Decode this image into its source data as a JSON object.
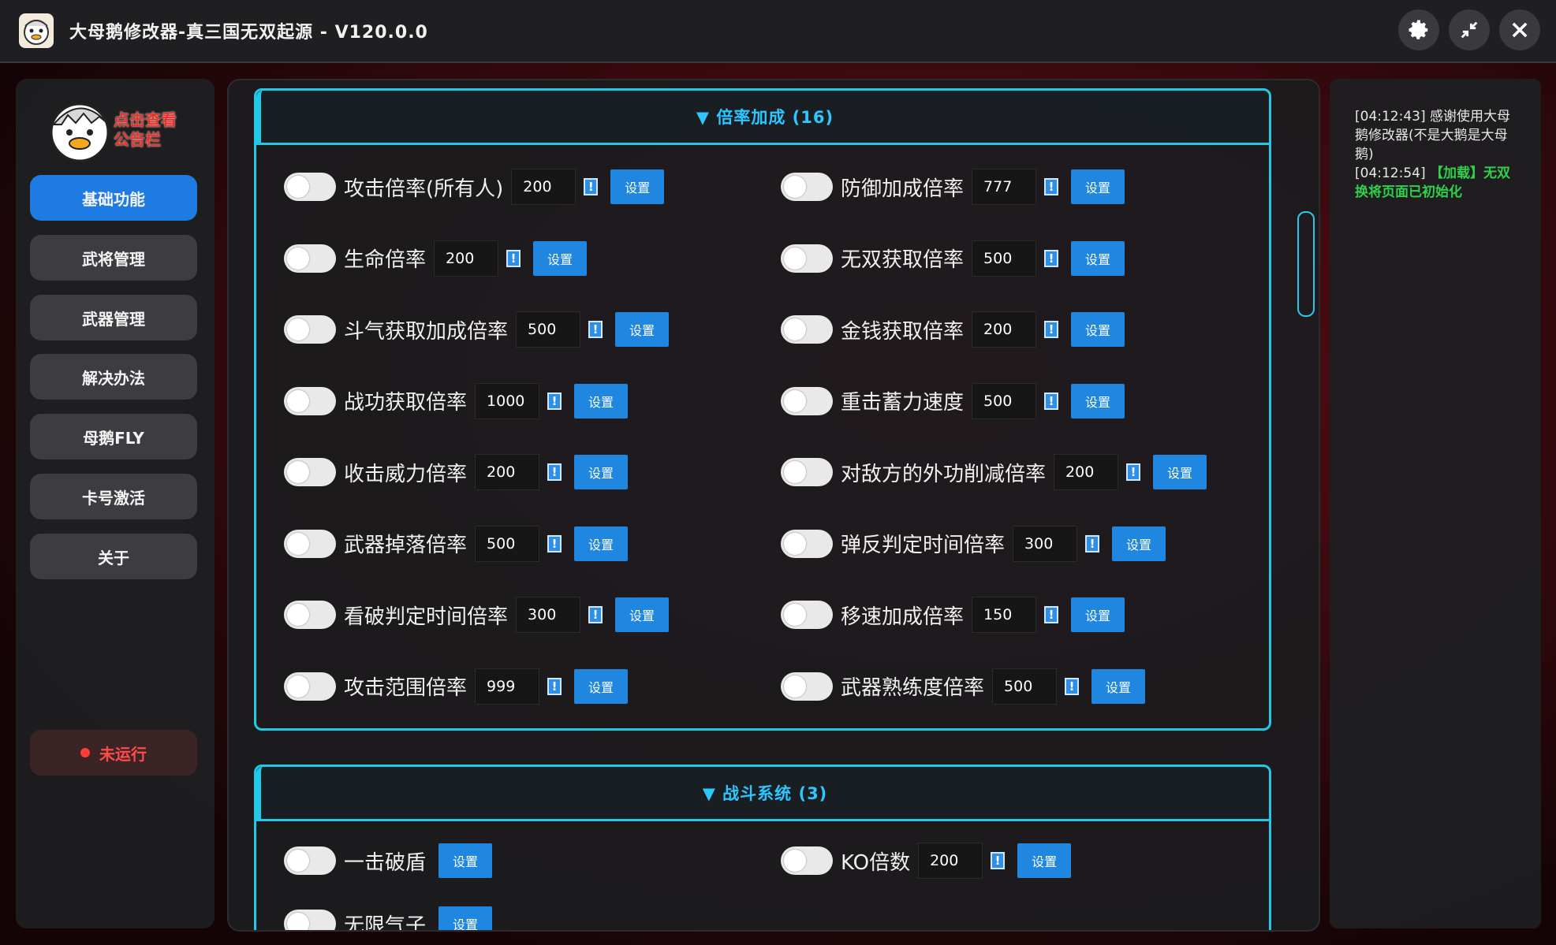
{
  "window": {
    "title": "大母鹅修改器-真三国无双起源 - V120.0.0"
  },
  "sidebar": {
    "notice_label": "点击查看公告栏",
    "items": [
      "基础功能",
      "武将管理",
      "武器管理",
      "解决办法",
      "母鹅FLY",
      "卡号激活",
      "关于"
    ],
    "active_index": 0,
    "status": "未运行"
  },
  "sections": [
    {
      "title": "▼ 倍率加成 (16)",
      "items": [
        {
          "label": "攻击倍率(所有人)",
          "value": "200",
          "button": "设置"
        },
        {
          "label": "防御加成倍率",
          "value": "777",
          "button": "设置"
        },
        {
          "label": "生命倍率",
          "value": "200",
          "button": "设置"
        },
        {
          "label": "无双获取倍率",
          "value": "500",
          "button": "设置"
        },
        {
          "label": "斗气获取加成倍率",
          "value": "500",
          "button": "设置"
        },
        {
          "label": "金钱获取倍率",
          "value": "200",
          "button": "设置"
        },
        {
          "label": "战功获取倍率",
          "value": "1000",
          "button": "设置"
        },
        {
          "label": "重击蓄力速度",
          "value": "500",
          "button": "设置"
        },
        {
          "label": "收击威力倍率",
          "value": "200",
          "button": "设置"
        },
        {
          "label": "对敌方的外功削减倍率",
          "value": "200",
          "button": "设置"
        },
        {
          "label": "武器掉落倍率",
          "value": "500",
          "button": "设置"
        },
        {
          "label": "弹反判定时间倍率",
          "value": "300",
          "button": "设置"
        },
        {
          "label": "看破判定时间倍率",
          "value": "300",
          "button": "设置"
        },
        {
          "label": "移速加成倍率",
          "value": "150",
          "button": "设置"
        },
        {
          "label": "攻击范围倍率",
          "value": "999",
          "button": "设置"
        },
        {
          "label": "武器熟练度倍率",
          "value": "500",
          "button": "设置"
        }
      ]
    },
    {
      "title": "▼ 战斗系统 (3)",
      "items": [
        {
          "label": "一击破盾",
          "value": "",
          "button": "设置"
        },
        {
          "label": "KO倍数",
          "value": "200",
          "button": "设置"
        },
        {
          "label": "无限气子",
          "value": "",
          "button": "设置"
        }
      ]
    }
  ],
  "info_glyph": "!",
  "log": {
    "line1_time": "[04:12:43]",
    "line1_text": "感谢使用大母鹅修改器(不是大鹅是大母鹅)",
    "line2_time": "[04:12:54]",
    "line2_text": "【加载】无双换将页面已初始化"
  },
  "colors": {
    "accent": "#1e7be3",
    "section_border": "#22c9e6",
    "status_red": "#ff3b3b",
    "log_green": "#2fd04b"
  }
}
